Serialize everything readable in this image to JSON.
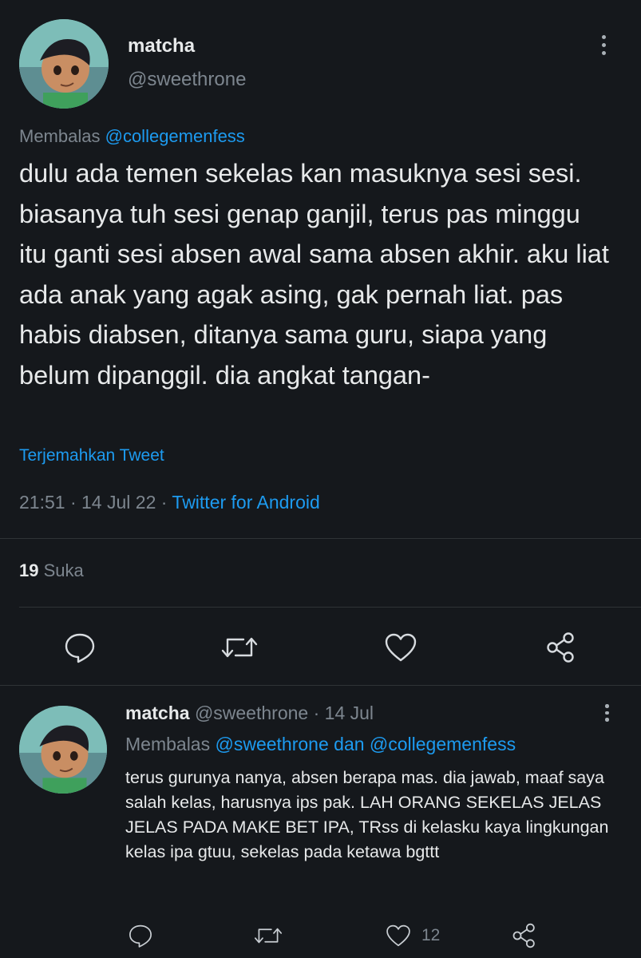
{
  "main_tweet": {
    "display_name": "matcha",
    "handle": "@sweethrone",
    "reply_prefix": "Membalas",
    "reply_to": "@collegemenfess",
    "text": "dulu ada temen sekelas kan masuknya sesi sesi. biasanya tuh sesi genap ganjil, terus pas minggu itu ganti sesi absen awal sama absen akhir. aku liat ada anak yang agak asing, gak pernah liat. pas habis diabsen, ditanya sama guru, siapa yang belum dipanggil. dia angkat tangan-",
    "translate_label": "Terjemahkan Tweet",
    "time": "21:51",
    "date": "14 Jul 22",
    "separator": "·",
    "source": "Twitter for Android",
    "likes_count": "19",
    "likes_label": "Suka"
  },
  "reply_tweet": {
    "display_name": "matcha",
    "handle": "@sweethrone",
    "separator": "·",
    "date": "14 Jul",
    "reply_prefix": "Membalas",
    "reply_to": "@sweethrone dan @collegemenfess",
    "text": "terus gurunya nanya, absen berapa mas. dia jawab, maaf saya salah kelas, harusnya ips pak. LAH ORANG SEKELAS JELAS JELAS PADA MAKE BET IPA, TRss di kelasku kaya lingkungan kelas ipa gtuu, sekelas pada ketawa bgttt",
    "like_count": "12"
  },
  "icons": {
    "reply": "reply-bubble-icon",
    "retweet": "retweet-icon",
    "like": "heart-icon",
    "share": "share-icon",
    "more": "more-vertical-icon"
  },
  "colors": {
    "background": "#15181c",
    "text": "#e7e9ea",
    "muted": "#7d868f",
    "link": "#1d9bf0",
    "divider": "#2f3336"
  }
}
